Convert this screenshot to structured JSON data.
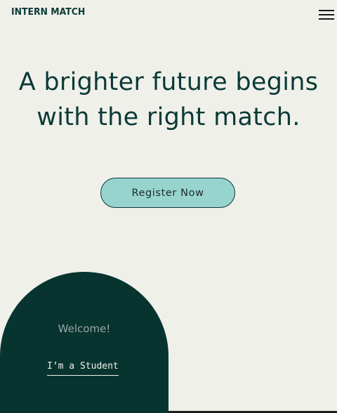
{
  "header": {
    "logo_text": "INTERN MATCH",
    "menu_icon": "hamburger-menu-icon"
  },
  "hero": {
    "title_line1": "A brighter future begins",
    "title_line2": "with the right match.",
    "register_label": "Register Now"
  },
  "card": {
    "welcome": "Welcome!",
    "student_link": "I’m a Student"
  },
  "colors": {
    "background": "#f0f0ea",
    "brand_dark": "#0b3a36",
    "card_bg": "#083430",
    "button_bg": "#97d4cd"
  }
}
